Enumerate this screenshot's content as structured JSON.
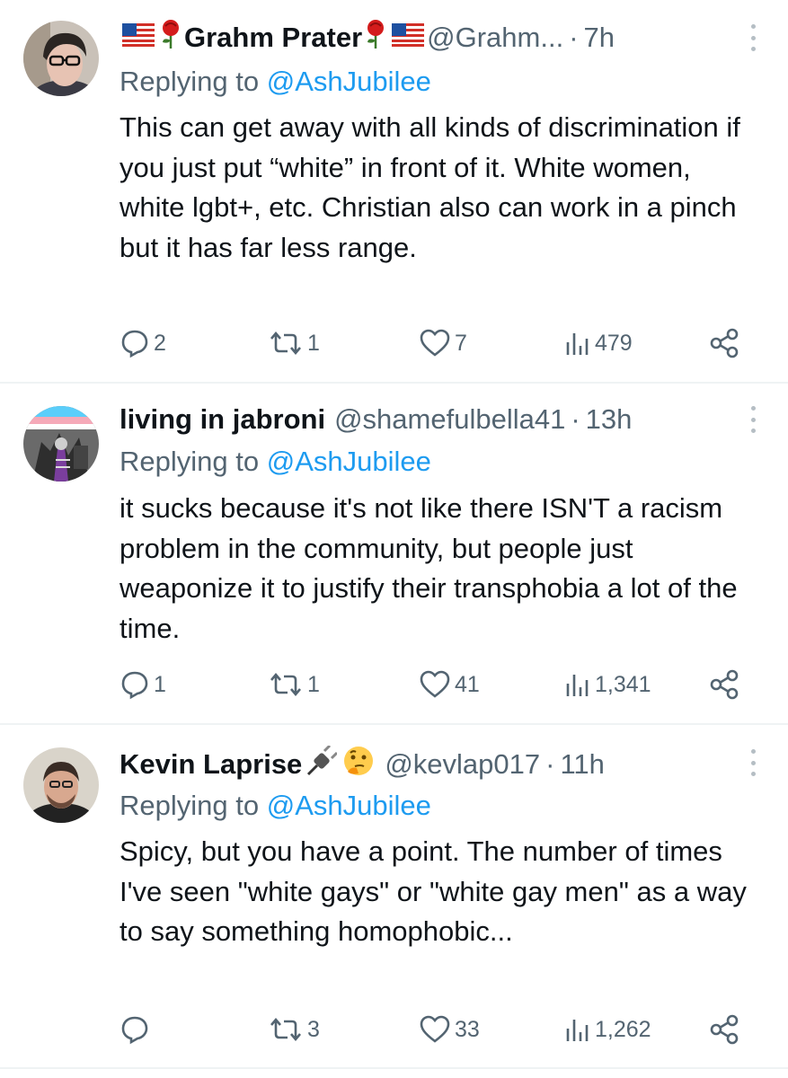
{
  "tweets": [
    {
      "name": "Grahm Prater",
      "handle": "@Grahm...",
      "time": "7h",
      "reply_prefix": "Replying to ",
      "reply_to": "@AshJubilee",
      "text": "This can get away with all kinds of discrimination if you just put “white” in front of it. White women, white lgbt+, etc. Christian also can work in a pinch but it has far less range.",
      "replies": "2",
      "reposts": "1",
      "likes": "7",
      "views": "479",
      "avatar_colors": {
        "bg": "#c9c1b8",
        "face": "#e7c3b3",
        "hair": "#2b2522"
      },
      "emojis": [
        "us-flag-icon",
        "rose-icon"
      ]
    },
    {
      "name": "living in jabroni",
      "handle": "@shamefulbella41",
      "time": "13h",
      "reply_prefix": "Replying to ",
      "reply_to": "@AshJubilee",
      "text": "it sucks because it's not like there ISN'T a racism problem in the community, but people just weaponize it to justify their transphobia a lot of the time.",
      "replies": "1",
      "reposts": "1",
      "likes": "41",
      "views": "1,341",
      "avatar_colors": {
        "bg": "#6a6a6a",
        "accent1": "#5bcefa",
        "accent2": "#f5a9b8"
      }
    },
    {
      "name": "Kevin Laprise",
      "handle": "@kevlap017",
      "time": "11h",
      "reply_prefix": "Replying to ",
      "reply_to": "@AshJubilee",
      "text": "Spicy, but you have a point. The number of times I've seen \"white gays\" or \"white gay men\" as a way to say something homophobic...",
      "replies": "",
      "reposts": "3",
      "likes": "33",
      "views": "1,262",
      "avatar_colors": {
        "bg": "#d9d4ca",
        "face": "#d8a88f",
        "hair": "#3a2c25"
      },
      "emojis": [
        "electric-plug-icon",
        "thinking-face-icon"
      ]
    }
  ],
  "colors": {
    "text": "#0f1419",
    "secondary": "#536471",
    "link": "#1d9bf0",
    "divider": "#eff3f4"
  },
  "separator": "·"
}
